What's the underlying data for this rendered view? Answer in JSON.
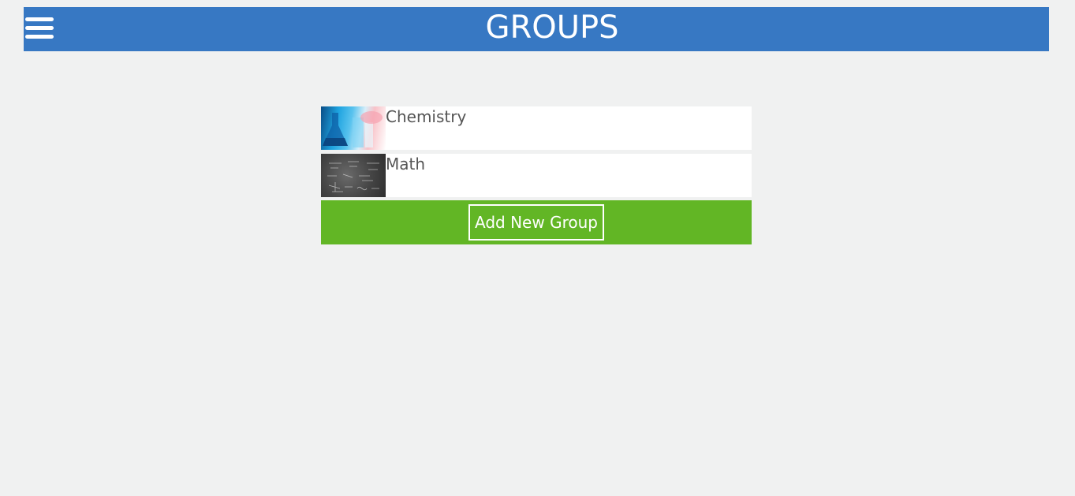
{
  "header": {
    "title": "GROUPS",
    "menu_icon": "hamburger-menu-icon",
    "background_color": "#3778c3"
  },
  "groups": [
    {
      "name": "Chemistry",
      "thumbnail": "chemistry-lab-glassware-image"
    },
    {
      "name": "Math",
      "thumbnail": "chalkboard-equations-image"
    }
  ],
  "actions": {
    "add_group_label": "Add New Group",
    "add_bar_color": "#62b625"
  }
}
